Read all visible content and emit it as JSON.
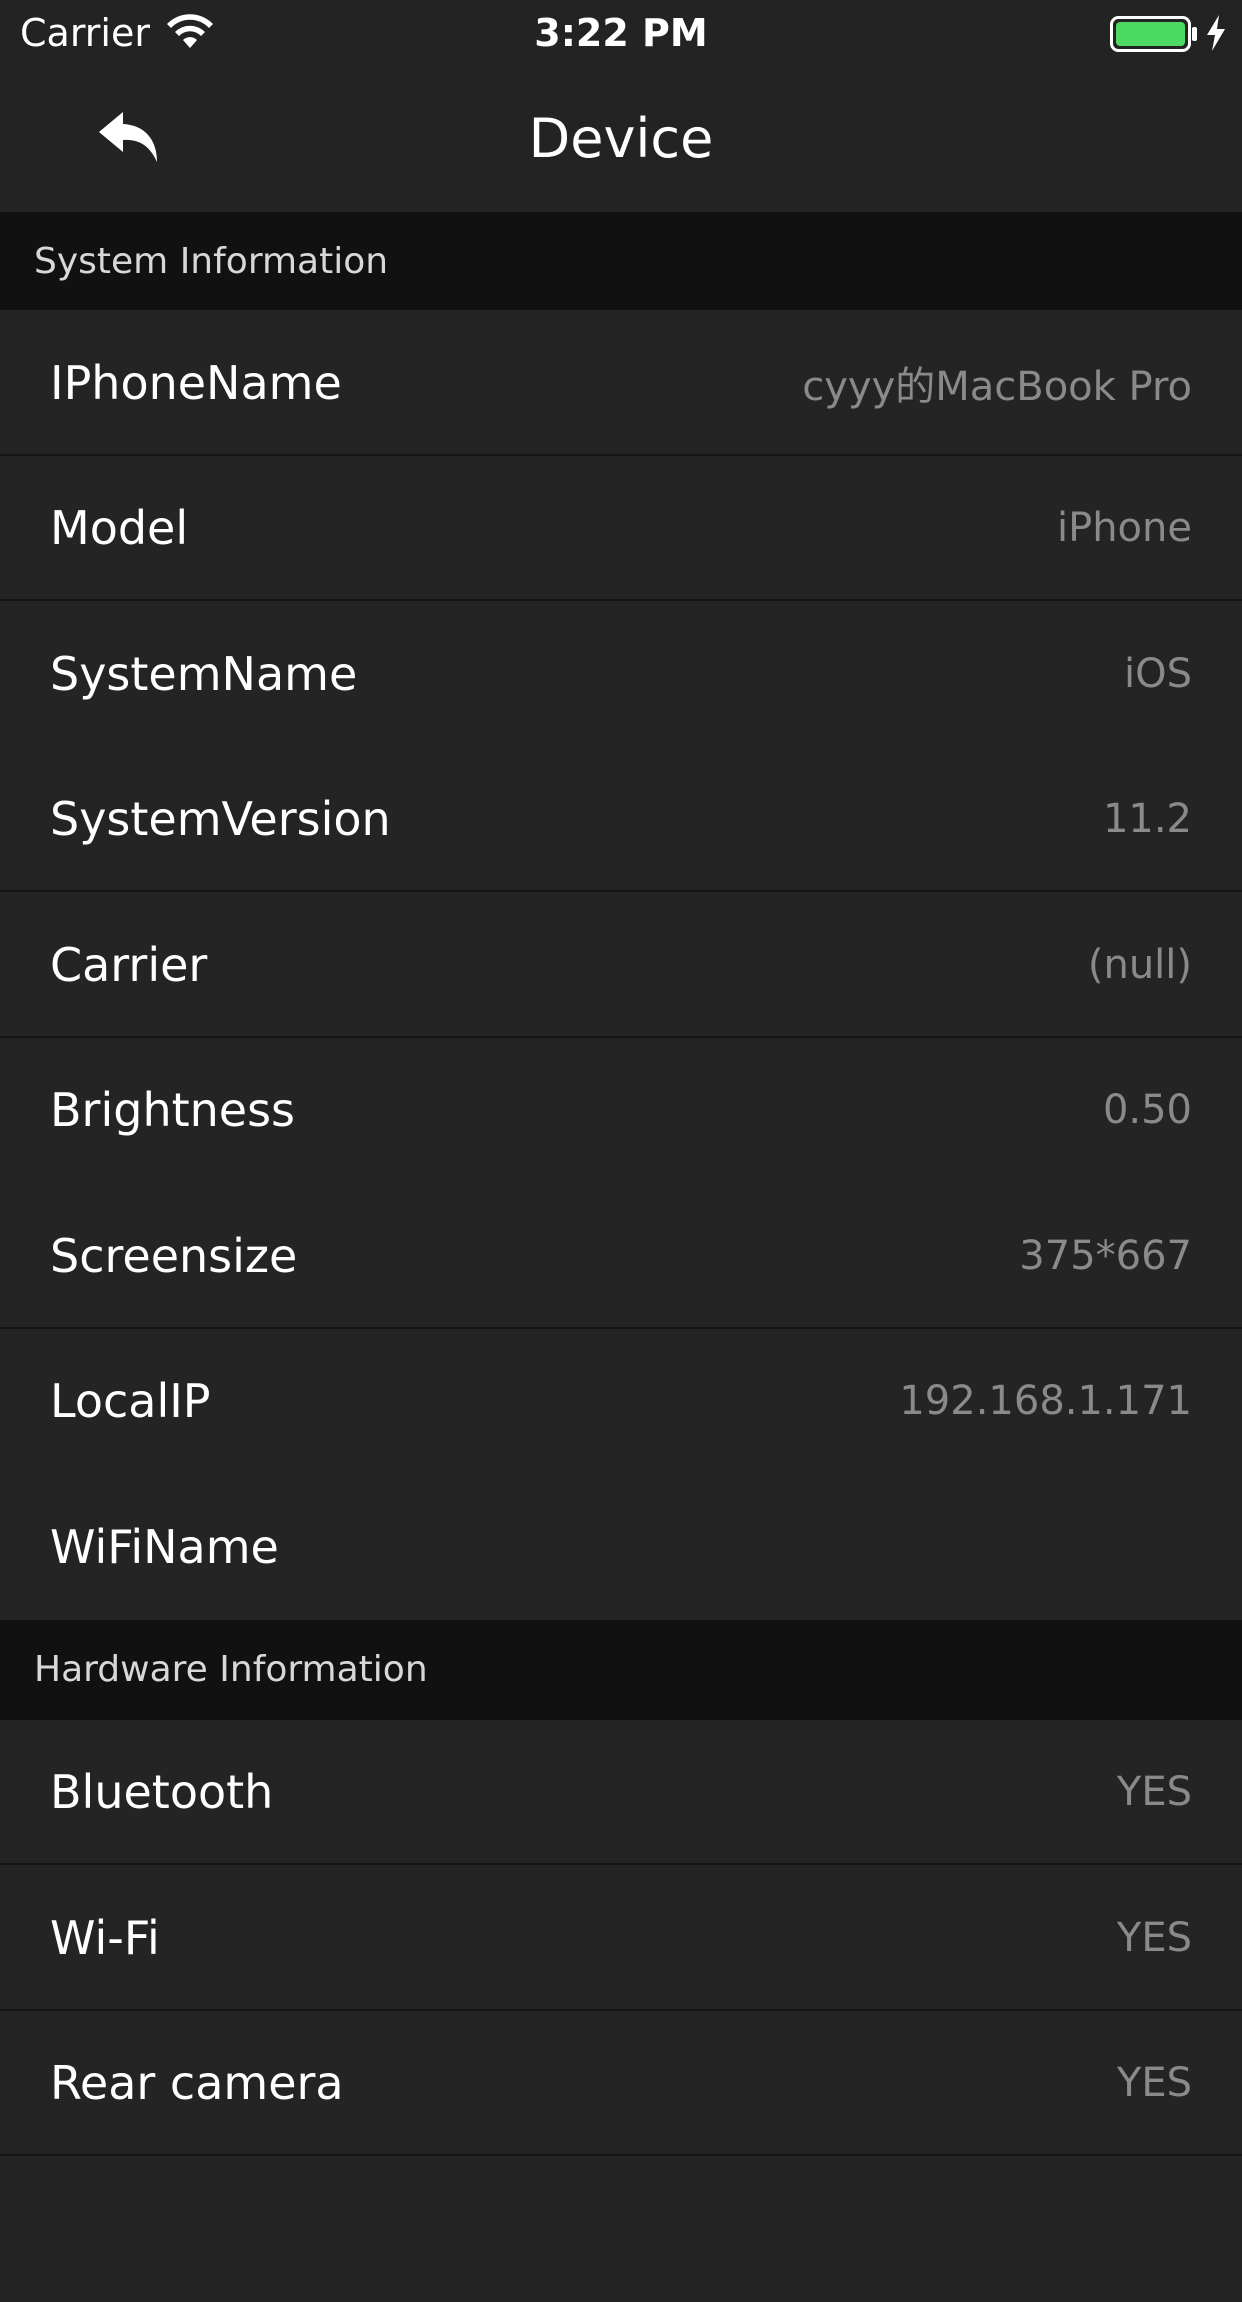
{
  "status_bar": {
    "carrier": "Carrier",
    "time": "3:22 PM",
    "battery_color": "#4cd964"
  },
  "nav": {
    "title": "Device",
    "back_icon": "undo-arrow-icon"
  },
  "sections": [
    {
      "header": "System Information",
      "rows": [
        {
          "label": "IPhoneName",
          "value": "cyyy的MacBook Pro"
        },
        {
          "label": "Model",
          "value": "iPhone"
        },
        {
          "label": "SystemName",
          "value": "iOS"
        },
        {
          "label": "SystemVersion",
          "value": "11.2"
        },
        {
          "label": "Carrier",
          "value": "(null)"
        },
        {
          "label": "Brightness",
          "value": "0.50"
        },
        {
          "label": "Screensize",
          "value": "375*667"
        },
        {
          "label": "LocalIP",
          "value": "192.168.1.171"
        },
        {
          "label": "WiFiName",
          "value": ""
        }
      ]
    },
    {
      "header": "Hardware Information",
      "rows": [
        {
          "label": "Bluetooth",
          "value": "YES"
        },
        {
          "label": "Wi-Fi",
          "value": "YES"
        },
        {
          "label": "Rear camera",
          "value": "YES"
        }
      ]
    }
  ]
}
